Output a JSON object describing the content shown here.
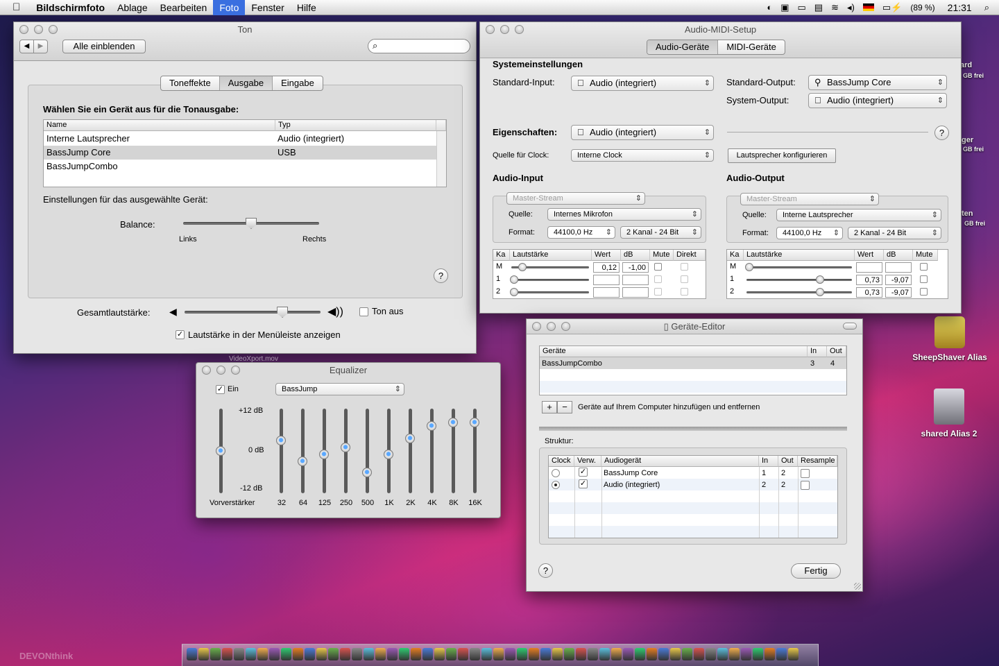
{
  "menubar": {
    "apple": "",
    "app": "Bildschirmfoto",
    "items": [
      "Ablage",
      "Bearbeiten",
      "Foto",
      "Fenster",
      "Hilfe"
    ],
    "battery": "(89 %)",
    "clock": "21:31"
  },
  "ton": {
    "title": "Ton",
    "show_all": "Alle einblenden",
    "search_placeholder": "",
    "tabs": [
      "Toneffekte",
      "Ausgabe",
      "Eingabe"
    ],
    "heading": "Wählen Sie ein Gerät aus für die Tonausgabe:",
    "col_name": "Name",
    "col_type": "Typ",
    "rows": [
      {
        "name": "Interne Lautsprecher",
        "type": "Audio (integriert)"
      },
      {
        "name": "BassJump Core",
        "type": "USB"
      },
      {
        "name": "BassJumpCombo",
        "type": ""
      }
    ],
    "settings_label": "Einstellungen für das ausgewählte Gerät:",
    "balance_label": "Balance:",
    "left": "Links",
    "right": "Rechts",
    "volume_label": "Gesamtlautstärke:",
    "mute_label": "Ton aus",
    "menubar_label": "Lautstärke in der Menüleiste anzeigen",
    "balance": 0.5,
    "volume": 0.72
  },
  "midi": {
    "title": "Audio-MIDI-Setup",
    "tabs": [
      "Audio-Geräte",
      "MIDI-Geräte"
    ],
    "sys_heading": "Systemeinstellungen",
    "std_input_label": "Standard-Input:",
    "std_input": "Audio (integriert)",
    "std_output_label": "Standard-Output:",
    "std_output": "BassJump Core",
    "sys_output_label": "System-Output:",
    "sys_output": "Audio (integriert)",
    "props_label": "Eigenschaften:",
    "props_device": "Audio (integriert)",
    "clock_label": "Quelle für Clock:",
    "clock_value": "Interne Clock",
    "speaker_btn": "Lautsprecher konfigurieren",
    "in_heading": "Audio-Input",
    "out_heading": "Audio-Output",
    "master_stream": "Master-Stream",
    "source_label": "Quelle:",
    "in_source": "Internes Mikrofon",
    "out_source": "Interne Lautsprecher",
    "format_label": "Format:",
    "rate": "44100,0 Hz",
    "channels": "2 Kanal - 24 Bit",
    "cols_in": [
      "Ka",
      "Lautstärke",
      "Wert",
      "dB",
      "Mute",
      "Direkt"
    ],
    "cols_out": [
      "Ka",
      "Lautstärke",
      "Wert",
      "dB",
      "Mute"
    ],
    "in_rows": [
      {
        "ch": "M",
        "wert": "0,12",
        "db": "-1,00",
        "level": 0.12
      },
      {
        "ch": "1",
        "wert": "",
        "db": "",
        "level": 0
      },
      {
        "ch": "2",
        "wert": "",
        "db": "",
        "level": 0
      }
    ],
    "out_rows": [
      {
        "ch": "M",
        "wert": "",
        "db": "",
        "level": 0
      },
      {
        "ch": "1",
        "wert": "0,73",
        "db": "-9,07",
        "level": 0.73
      },
      {
        "ch": "2",
        "wert": "0,73",
        "db": "-9,07",
        "level": 0.73
      }
    ]
  },
  "editor": {
    "title": "Geräte-Editor",
    "col_devices": "Geräte",
    "col_in": "In",
    "col_out": "Out",
    "device_row": {
      "name": "BassJumpCombo",
      "in": "3",
      "out": "4"
    },
    "add_remove_label": "Geräte auf Ihrem Computer hinzufügen und entfernen",
    "structure_label": "Struktur:",
    "struct_cols": [
      "Clock",
      "Verw.",
      "Audiogerät",
      "In",
      "Out",
      "Resample"
    ],
    "struct_rows": [
      {
        "device": "BassJump Core",
        "in": "1",
        "out": "2",
        "clock": false
      },
      {
        "device": "Audio (integriert)",
        "in": "2",
        "out": "2",
        "clock": true
      }
    ],
    "done": "Fertig"
  },
  "eq": {
    "title": "Equalizer",
    "behind_title": "VideoXport.mov",
    "on_label": "Ein",
    "preset": "BassJump",
    "top_db": "+12 dB",
    "mid_db": "0 dB",
    "bot_db": "-12 dB",
    "preamp_label": "Vorverstärker",
    "preamp": 0,
    "bands": [
      {
        "label": "32",
        "db": 3
      },
      {
        "label": "64",
        "db": -3
      },
      {
        "label": "125",
        "db": -1
      },
      {
        "label": "250",
        "db": 1
      },
      {
        "label": "500",
        "db": -6
      },
      {
        "label": "1K",
        "db": -1
      },
      {
        "label": "2K",
        "db": 3.5
      },
      {
        "label": "4K",
        "db": 7
      },
      {
        "label": "8K",
        "db": 8
      },
      {
        "label": "16K",
        "db": 8
      }
    ]
  },
  "desktop": {
    "icon1": "SheepShaver Alias",
    "icon2": "shared Alias 2",
    "partial1": "ard",
    "partial2": "GB frei",
    "partial3": "ger",
    "partial4": "GB frei",
    "partial5": "ten",
    "partial6": "GB frei",
    "watermark": "DEVONthink"
  }
}
